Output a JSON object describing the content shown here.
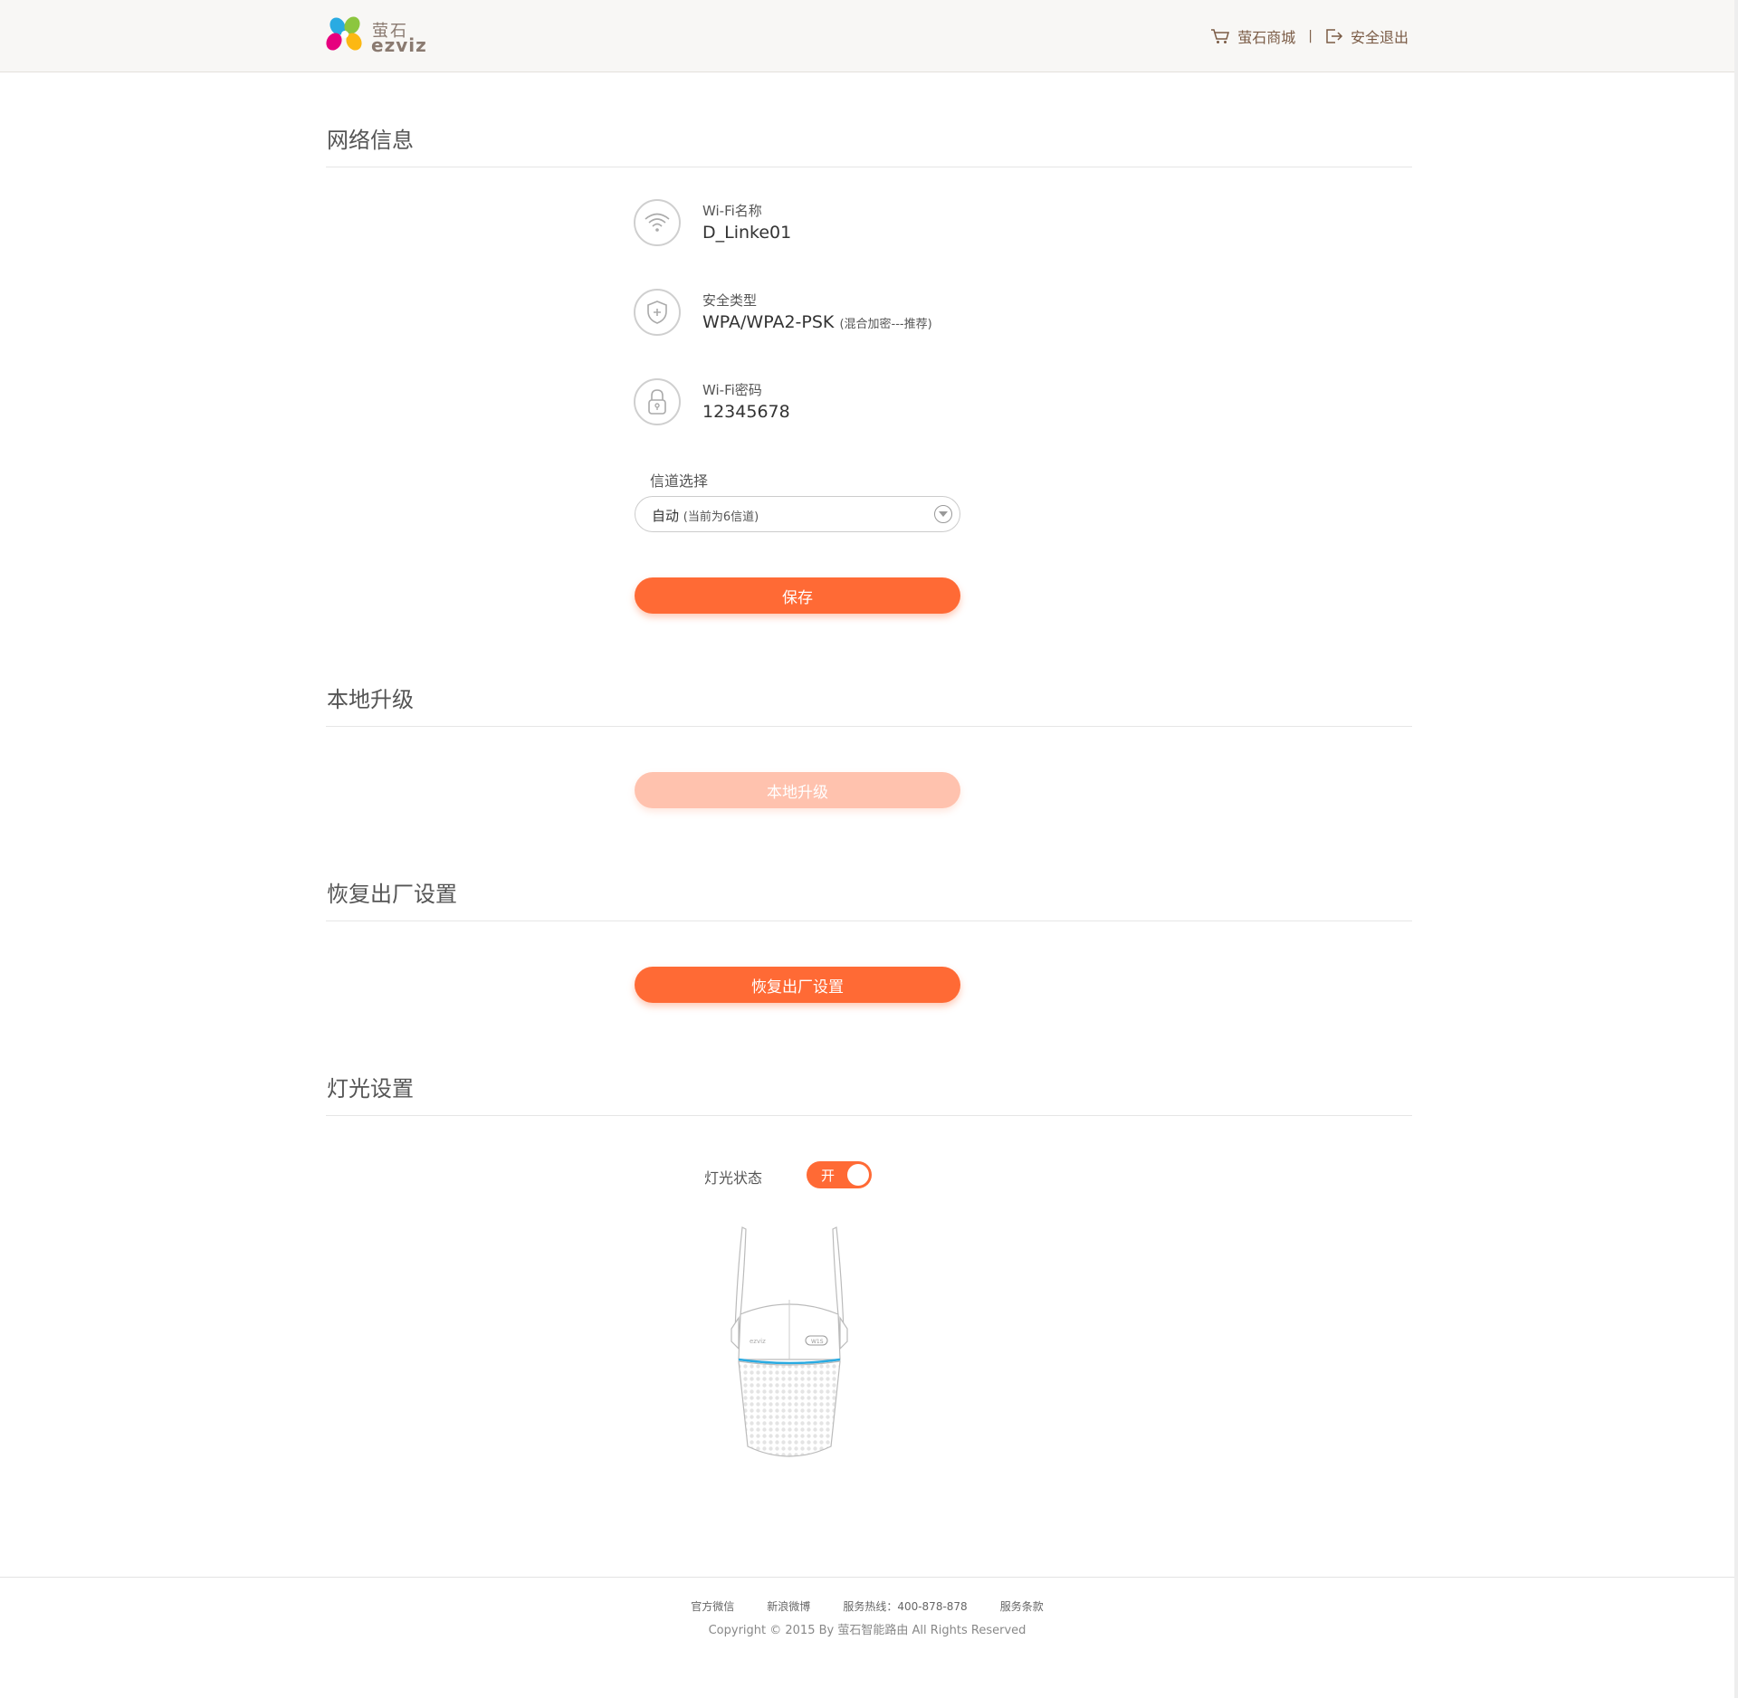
{
  "header": {
    "logo": {
      "cn": "萤石",
      "en": "ezviz"
    },
    "nav": {
      "shop_label": "萤石商城",
      "separator": "|",
      "logout_label": "安全退出"
    }
  },
  "network": {
    "title": "网络信息",
    "wifi_name_label": "Wi-Fi名称",
    "wifi_name_value": "D_Linke01",
    "security_label": "安全类型",
    "security_value": "WPA/WPA2-PSK",
    "security_note": "(混合加密---推荐)",
    "password_label": "Wi-Fi密码",
    "password_value": "12345678",
    "channel_label": "信道选择",
    "channel_value": "自动",
    "channel_note": "(当前为6信道)",
    "save_label": "保存"
  },
  "upgrade": {
    "title": "本地升级",
    "button_label": "本地升级"
  },
  "reset": {
    "title": "恢复出厂设置",
    "button_label": "恢复出厂设置"
  },
  "light": {
    "title": "灯光设置",
    "status_label": "灯光状态",
    "toggle_label": "开",
    "toggle_on": true
  },
  "device_image": {
    "brand": "ezviz",
    "model": "W1S"
  },
  "footer": {
    "links": [
      "官方微信",
      "新浪微博",
      "服务热线：400-878-878",
      "服务条款"
    ],
    "copyright": "Copyright © 2015 By 萤石智能路由 All Rights Reserved"
  },
  "colors": {
    "accent": "#ff6a35",
    "accent_disabled": "#ffc2ae",
    "nav_text": "#7a5b45"
  }
}
